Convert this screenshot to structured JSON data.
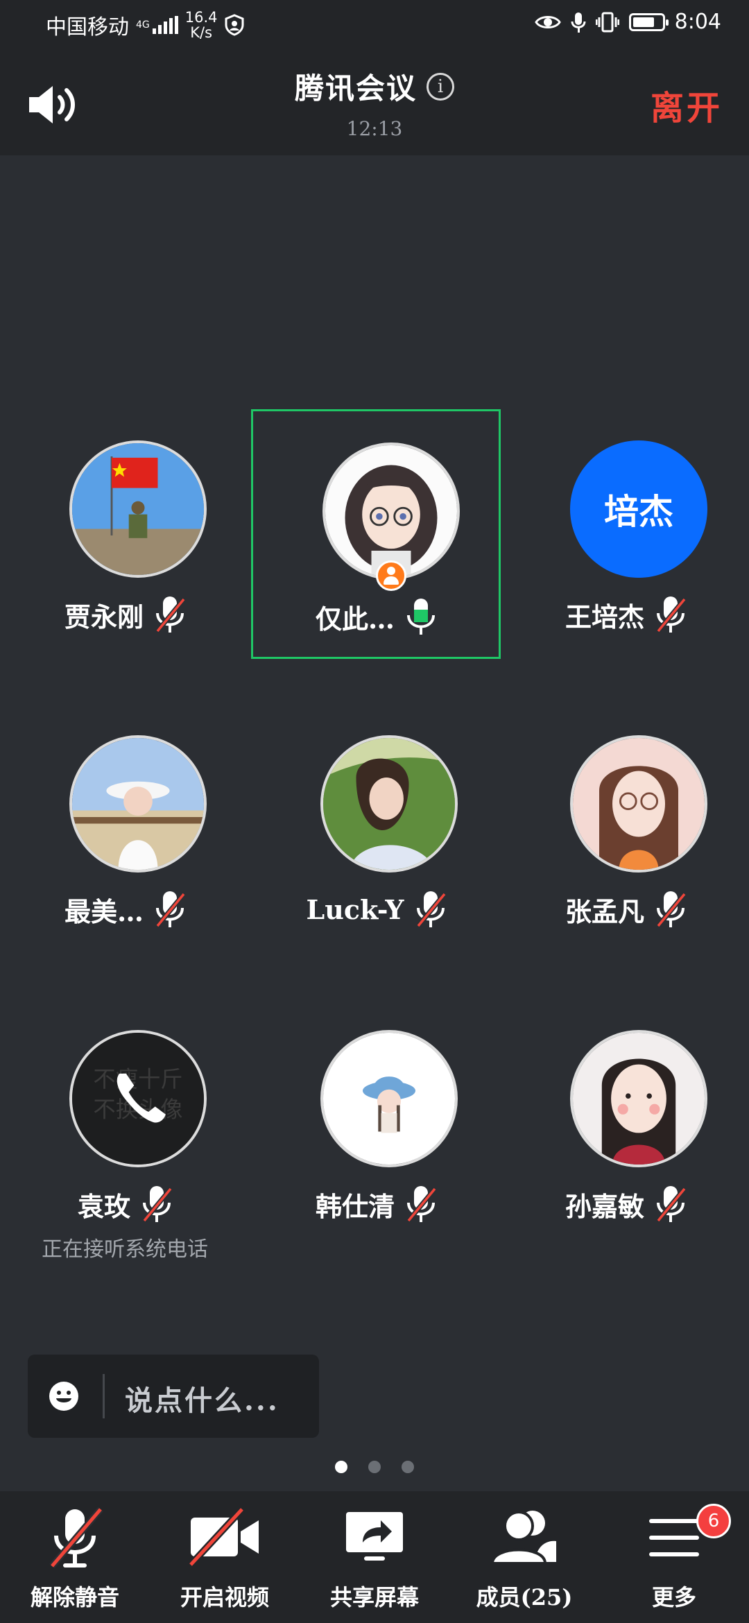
{
  "status_bar": {
    "carrier": "中国移动",
    "network": "4G",
    "speed_value": "16.4",
    "speed_unit": "K/s",
    "time": "8:04",
    "battery_level": 0.75
  },
  "header": {
    "title": "腾讯会议",
    "timer": "12:13",
    "leave_label": "离开"
  },
  "participants": [
    {
      "name": "贾永刚",
      "mic": "muted",
      "avatar": "flag-soldier-photo"
    },
    {
      "name": "仅此…",
      "mic": "speaking",
      "avatar": "cartoon-girl-glasses",
      "host": true,
      "active": true
    },
    {
      "name": "王培杰",
      "mic": "muted",
      "avatar_text": "培杰",
      "avatar_color": "#0a6cff"
    },
    {
      "name": "最美…",
      "mic": "muted",
      "avatar": "woman-hat-photo"
    },
    {
      "name": "Luck-Y",
      "mic": "muted",
      "avatar": "woman-grass-photo"
    },
    {
      "name": "张孟凡",
      "mic": "muted",
      "avatar": "cartoon-woman-glasses"
    },
    {
      "name": "袁玫",
      "mic": "muted",
      "avatar": "phone-call-overlay",
      "sub_status": "正在接听系统电话"
    },
    {
      "name": "韩仕清",
      "mic": "muted",
      "avatar": "cartoon-girl-hat"
    },
    {
      "name": "孙嘉敏",
      "mic": "muted",
      "avatar": "cartoon-woman-red"
    }
  ],
  "chat": {
    "placeholder": "说点什么..."
  },
  "pager": {
    "pages": 3,
    "current": 1
  },
  "toolbar": {
    "unmute_label": "解除静音",
    "video_label": "开启视频",
    "share_label": "共享屏幕",
    "members_label": "成员(25)",
    "more_label": "更多",
    "more_badge": "6"
  },
  "colors": {
    "accent_red": "#f0453a",
    "speaking_green": "#1fc766",
    "host_orange": "#ff7a1a"
  }
}
